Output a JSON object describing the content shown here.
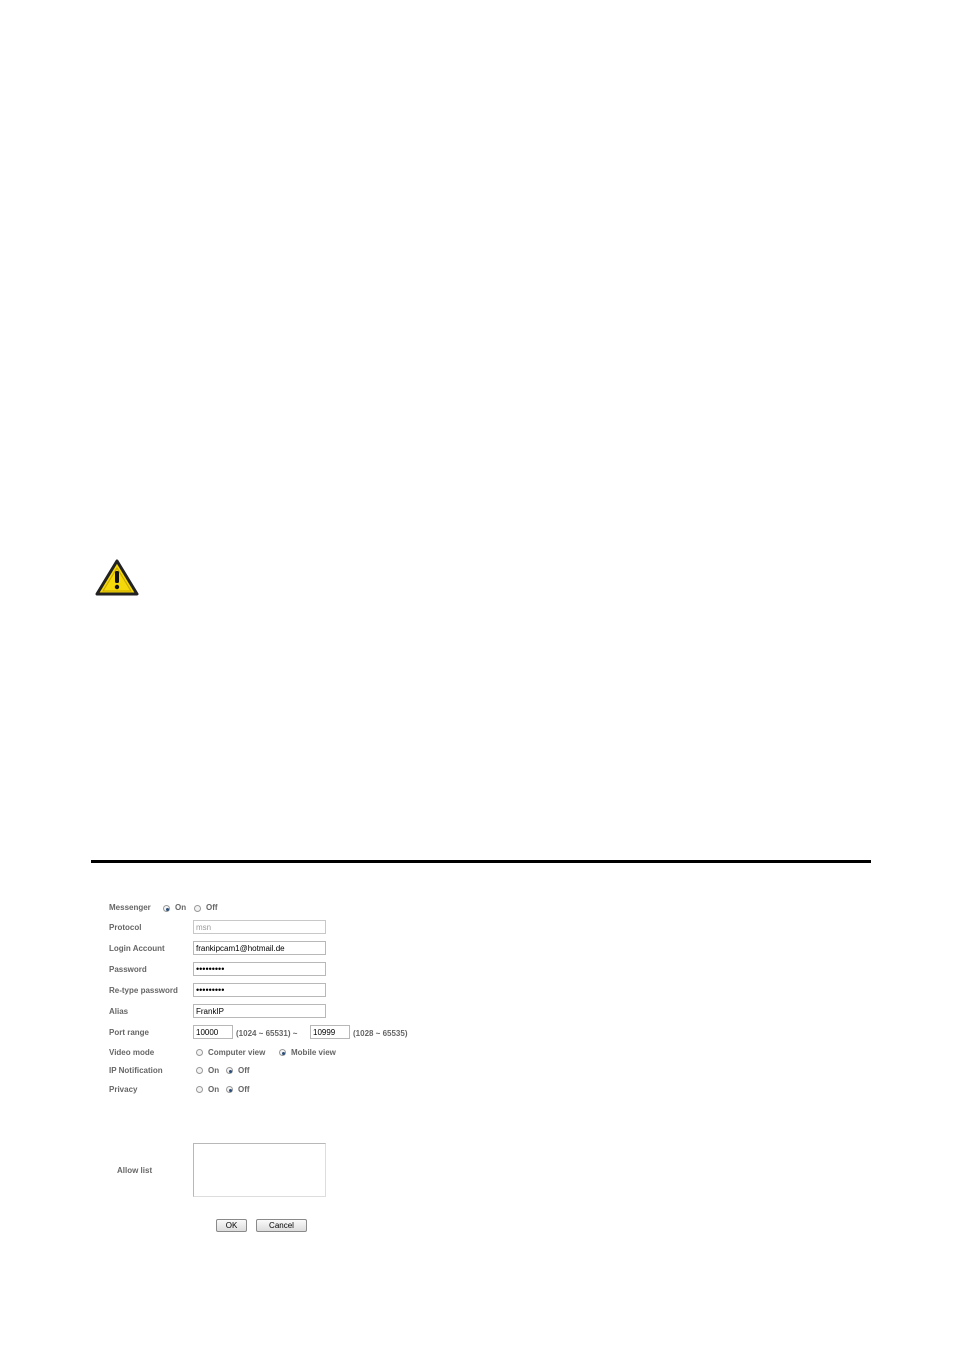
{
  "form": {
    "messenger": {
      "label": "Messenger",
      "on": "On",
      "off": "Off",
      "selected": "On"
    },
    "protocol": {
      "label": "Protocol",
      "value": "msn"
    },
    "login_account": {
      "label": "Login Account",
      "value": "frankipcam1@hotmail.de"
    },
    "password": {
      "label": "Password",
      "value": "•••••••••"
    },
    "retype_password": {
      "label": "Re-type password",
      "value": "•••••••••"
    },
    "alias": {
      "label": "Alias",
      "value": "FrankIP"
    },
    "port_range": {
      "label": "Port range",
      "start": "10000",
      "start_hint": "(1024 ~ 65531) ~",
      "end": "10999",
      "end_hint": "(1028 ~ 65535)"
    },
    "video_mode": {
      "label": "Video mode",
      "computer": "Computer view",
      "mobile": "Mobile view",
      "selected": "Mobile view"
    },
    "ip_notification": {
      "label": "IP Notification",
      "on": "On",
      "off": "Off",
      "selected": "Off"
    },
    "privacy": {
      "label": "Privacy",
      "on": "On",
      "off": "Off",
      "selected": "Off"
    },
    "allow_list": {
      "label": "Allow list",
      "value": ""
    },
    "ok_label": "OK",
    "cancel_label": "Cancel"
  },
  "icons": {
    "warning": "warning-triangle-icon"
  },
  "colors": {
    "warning_fill": "#f5d90a",
    "rule": "#000000"
  }
}
